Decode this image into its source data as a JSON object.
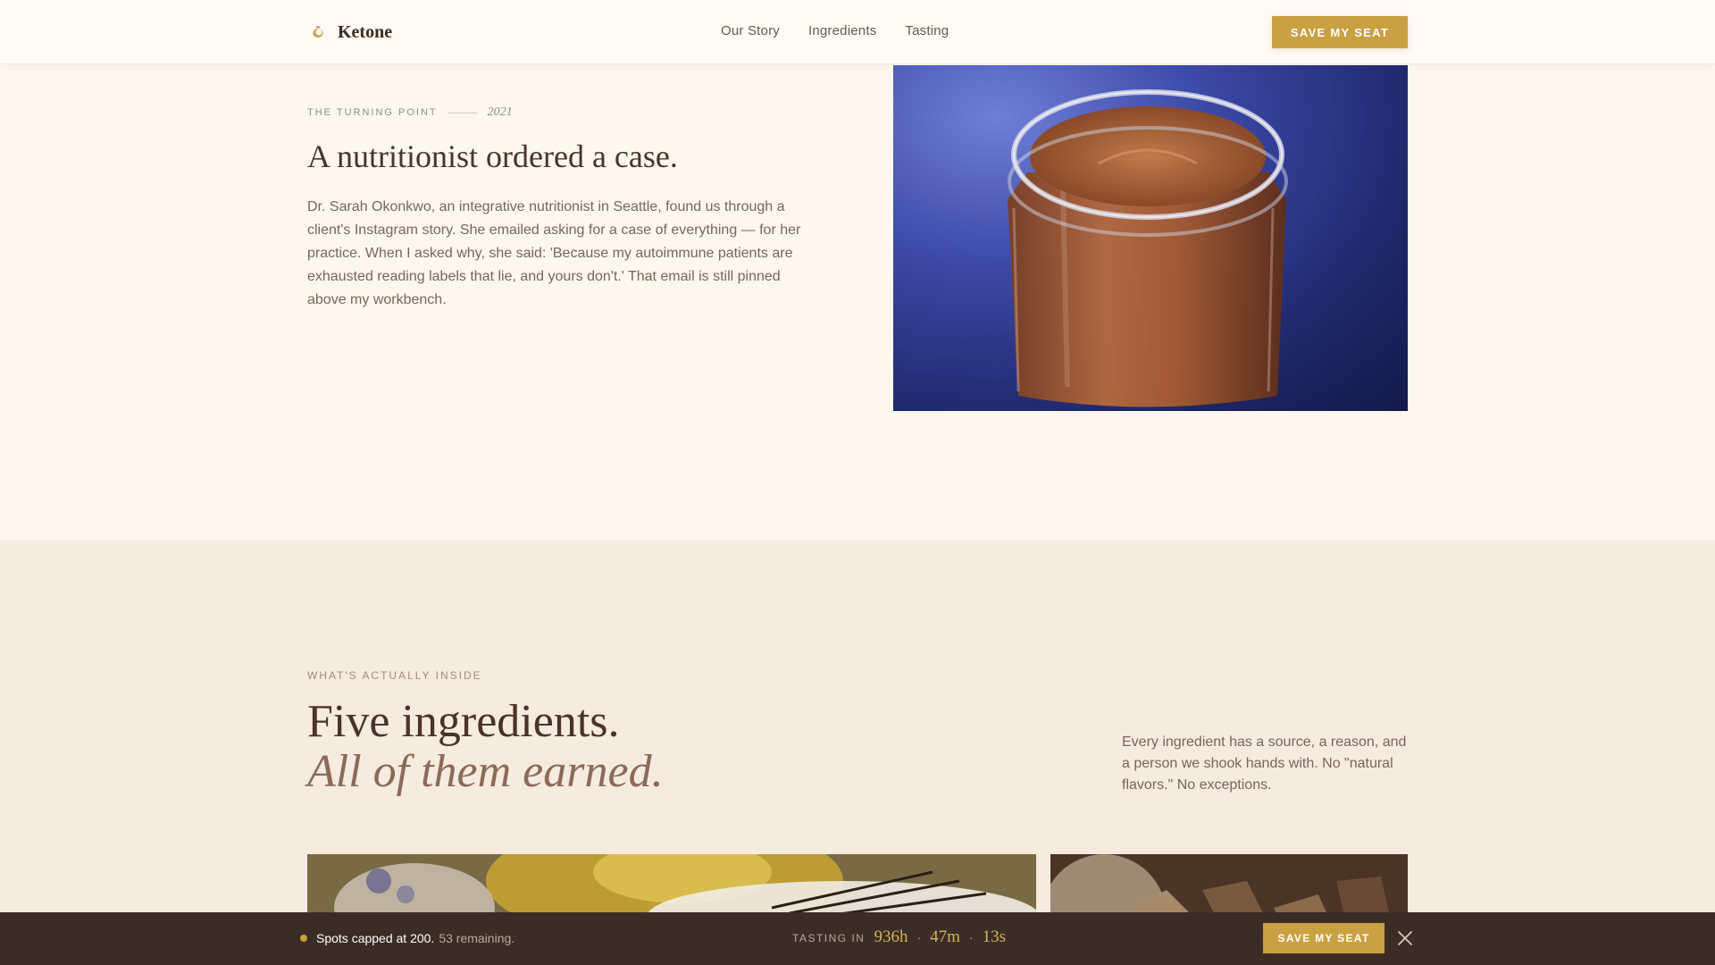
{
  "header": {
    "brand": "Ketone",
    "nav": [
      "Our Story",
      "Ingredients",
      "Tasting"
    ],
    "cta": "SAVE MY SEAT"
  },
  "story": {
    "eyebrow": "THE TURNING POINT",
    "year": "2021",
    "title": "A nutritionist ordered a case.",
    "body": "Dr. Sarah Okonkwo, an integrative nutritionist in Seattle, found us through a client's Instagram story. She emailed asking for a case of everything — for her practice. When I asked why, she said: 'Because my autoimmune patients are exhausted reading labels that lie, and yours don't.' That email is still pinned above my workbench."
  },
  "ingredients": {
    "eyebrow": "WHAT'S ACTUALLY INSIDE",
    "title_line1": "Five ingredients.",
    "title_line2": "All of them earned.",
    "description": "Every ingredient has a source, a reason, and a person we shook hands with. No \"natural flavors.\" No exceptions."
  },
  "bottom_bar": {
    "spots_main": "Spots capped at 200.",
    "spots_remaining": "53 remaining.",
    "timer_label": "TASTING IN",
    "hours": "936h",
    "minutes": "47m",
    "seconds": "13s",
    "separator": "·",
    "cta": "SAVE MY SEAT"
  },
  "colors": {
    "accent_gold": "#c9a042",
    "bar_bg": "#3b2d26",
    "page_bg": "#fdf7ef"
  },
  "icons": {
    "brand": "nut-logo-icon",
    "close": "close-icon"
  }
}
